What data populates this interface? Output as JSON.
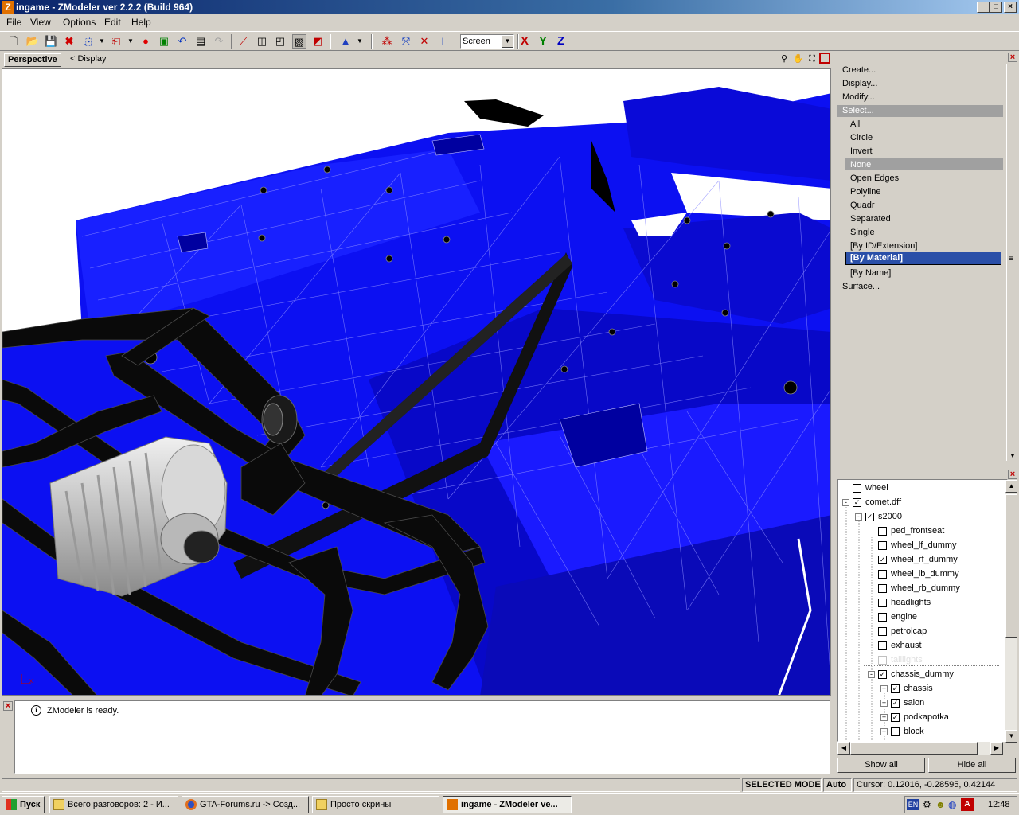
{
  "window": {
    "title": "ingame - ZModeler ver 2.2.2 (Build 964)",
    "app_icon": "zmodeler-icon",
    "buttons": [
      "_",
      "□",
      "×"
    ]
  },
  "menu": [
    "File",
    "View",
    "Options",
    "Edit",
    "Help"
  ],
  "toolbar": {
    "view_select": "Screen",
    "axes": [
      "X",
      "Y",
      "Z"
    ],
    "axis_colors": {
      "X": "#c00000",
      "Y": "#008000",
      "Z": "#0000c0"
    }
  },
  "viewport": {
    "tab_label": "Perspective",
    "display_label": "< Display"
  },
  "log": {
    "message": "ZModeler is ready."
  },
  "command_panel": {
    "items": [
      {
        "label": "Create...",
        "level": 0
      },
      {
        "label": "Display...",
        "level": 0
      },
      {
        "label": "Modify...",
        "level": 0
      },
      {
        "label": "Select...",
        "level": 0,
        "state": "header"
      },
      {
        "label": "All",
        "level": 1
      },
      {
        "label": "Circle",
        "level": 1
      },
      {
        "label": "Invert",
        "level": 1
      },
      {
        "label": "None",
        "level": 1,
        "state": "header"
      },
      {
        "label": "Open Edges",
        "level": 1
      },
      {
        "label": "Polyline",
        "level": 1
      },
      {
        "label": "Quadr",
        "level": 1
      },
      {
        "label": "Separated",
        "level": 1
      },
      {
        "label": "Single",
        "level": 1
      },
      {
        "label": "[By ID/Extension]",
        "level": 1
      },
      {
        "label": "[By Material]",
        "level": 1,
        "state": "selected"
      },
      {
        "label": "[By Name]",
        "level": 1
      },
      {
        "label": "Surface...",
        "level": 0
      }
    ]
  },
  "hierarchy": {
    "items": [
      {
        "label": "wheel",
        "checked": false,
        "depth": 0,
        "expander": ""
      },
      {
        "label": "comet.dff",
        "checked": true,
        "depth": 0,
        "expander": "-"
      },
      {
        "label": "s2000",
        "checked": true,
        "depth": 1,
        "expander": "-"
      },
      {
        "label": "ped_frontseat",
        "checked": false,
        "depth": 2,
        "expander": ""
      },
      {
        "label": "wheel_lf_dummy",
        "checked": false,
        "depth": 2,
        "expander": ""
      },
      {
        "label": "wheel_rf_dummy",
        "checked": true,
        "depth": 2,
        "expander": ""
      },
      {
        "label": "wheel_lb_dummy",
        "checked": false,
        "depth": 2,
        "expander": ""
      },
      {
        "label": "wheel_rb_dummy",
        "checked": false,
        "depth": 2,
        "expander": ""
      },
      {
        "label": "headlights",
        "checked": false,
        "depth": 2,
        "expander": ""
      },
      {
        "label": "engine",
        "checked": false,
        "depth": 2,
        "expander": ""
      },
      {
        "label": "petrolcap",
        "checked": false,
        "depth": 2,
        "expander": ""
      },
      {
        "label": "exhaust",
        "checked": false,
        "depth": 2,
        "expander": ""
      },
      {
        "label": "taillights",
        "checked": false,
        "depth": 2,
        "expander": "",
        "state": "dim"
      },
      {
        "label": "chassis_dummy",
        "checked": true,
        "depth": 2,
        "expander": "-"
      },
      {
        "label": "chassis",
        "checked": true,
        "depth": 3,
        "expander": "+"
      },
      {
        "label": "salon",
        "checked": true,
        "depth": 3,
        "expander": "+"
      },
      {
        "label": "podkapotka",
        "checked": true,
        "depth": 3,
        "expander": "+"
      },
      {
        "label": "block",
        "checked": false,
        "depth": 3,
        "expander": "+"
      }
    ],
    "show_all": "Show all",
    "hide_all": "Hide all"
  },
  "status": {
    "mode": "SELECTED MODE",
    "auto": "Auto",
    "cursor": "Cursor: 0.12016, -0.28595, 0.42144"
  },
  "taskbar": {
    "start": "Пуск",
    "tasks": [
      {
        "label": "Всего разговоров: 2 - И...",
        "icon": "folder-icon"
      },
      {
        "label": "GTA-Forums.ru -> Созд...",
        "icon": "firefox-icon"
      },
      {
        "label": "Просто скрины",
        "icon": "folder-icon"
      },
      {
        "label": "ingame - ZModeler ve...",
        "icon": "zmodeler-icon",
        "active": true
      }
    ],
    "lang": "EN",
    "clock": "12:48"
  },
  "colors": {
    "mesh_blue": "#0a0af0",
    "title_start": "#0a246a",
    "selected": "#2a4fa8"
  }
}
